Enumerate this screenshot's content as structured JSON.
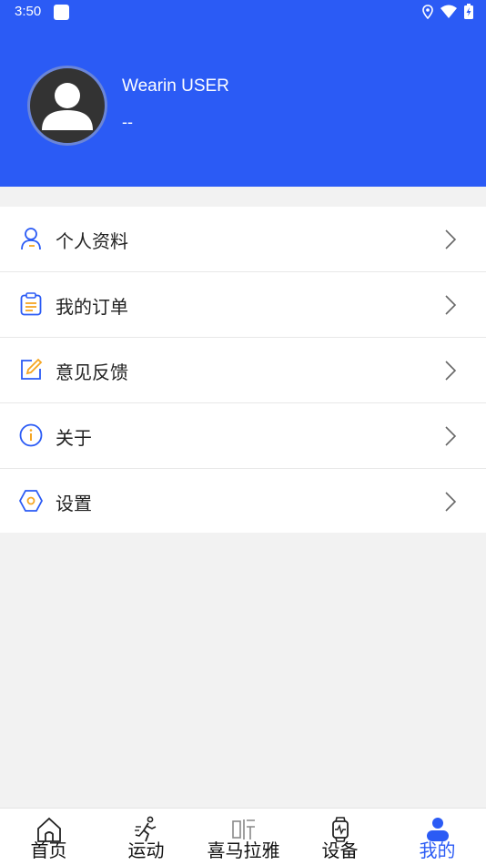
{
  "status_bar": {
    "time": "3:50"
  },
  "profile": {
    "name": "Wearin USER",
    "subtitle": "--"
  },
  "menu": [
    {
      "label": "个人资料",
      "icon": "person-icon"
    },
    {
      "label": "我的订单",
      "icon": "clipboard-icon"
    },
    {
      "label": "意见反馈",
      "icon": "edit-icon"
    },
    {
      "label": "关于",
      "icon": "info-icon"
    },
    {
      "label": "设置",
      "icon": "hexagon-settings-icon"
    }
  ],
  "tabs": [
    {
      "label": "首页",
      "icon": "home-icon"
    },
    {
      "label": "运动",
      "icon": "running-icon"
    },
    {
      "label": "喜马拉雅",
      "icon": "listen-icon"
    },
    {
      "label": "设备",
      "icon": "watch-icon"
    },
    {
      "label": "我的",
      "icon": "user-icon",
      "active": true
    }
  ],
  "colors": {
    "primary": "#2b5bf5",
    "accent_orange": "#f5a623",
    "background": "#f2f2f2"
  }
}
